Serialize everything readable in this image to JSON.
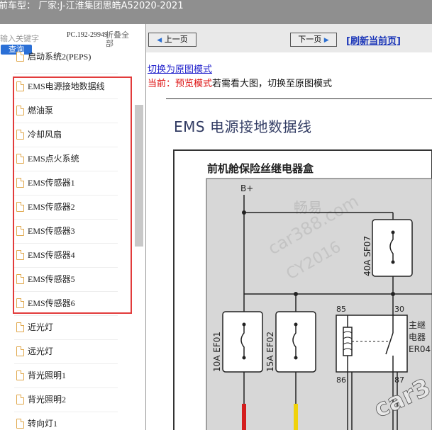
{
  "window": {
    "title": "前车型：  厂家:J-江淮集团思皓A52020-2021"
  },
  "search": {
    "placeholder": "输入关键字",
    "query_button": "查询"
  },
  "pc_label": "PC.192-29949",
  "fold_all_label": "折叠全部",
  "tree": {
    "items": [
      {
        "label": "启动系统2(PEPS)"
      },
      {
        "label": "EMS电源接地数据线"
      },
      {
        "label": "燃油泵"
      },
      {
        "label": "冷却风扇"
      },
      {
        "label": "EMS点火系统"
      },
      {
        "label": "EMS传感器1"
      },
      {
        "label": "EMS传感器2"
      },
      {
        "label": "EMS传感器3"
      },
      {
        "label": "EMS传感器4"
      },
      {
        "label": "EMS传感器5"
      },
      {
        "label": "EMS传感器6"
      },
      {
        "label": "近光灯"
      },
      {
        "label": "远光灯"
      },
      {
        "label": "背光照明1"
      },
      {
        "label": "背光照明2"
      },
      {
        "label": "转向灯1"
      }
    ]
  },
  "nav": {
    "prev_label": "上一页",
    "next_label": "下一页",
    "refresh_label": "[刷新当前页]"
  },
  "view": {
    "switch_link": "切换为原图模式",
    "current_prefix": "当前：预览模式",
    "current_suffix": "若需看大图，切换至原图模式"
  },
  "diagram": {
    "title": "EMS 电源接地数据线",
    "box_title": "前机舱保险丝继电器盒",
    "bplus": "B+",
    "watermark_1": "畅易",
    "watermark_2": "car388.com",
    "watermark_3": "CY2016",
    "corner_watermark": "car3",
    "fuse_sf07": "40A  SF07",
    "fuse_ef01": "10A  EF01",
    "fuse_ef02": "15A  EF02",
    "relay_label_1": "主继",
    "relay_label_2": "电器",
    "relay_label_3": "ER04",
    "pin_85": "85",
    "pin_30": "30",
    "pin_86": "86",
    "pin_87": "87"
  }
}
